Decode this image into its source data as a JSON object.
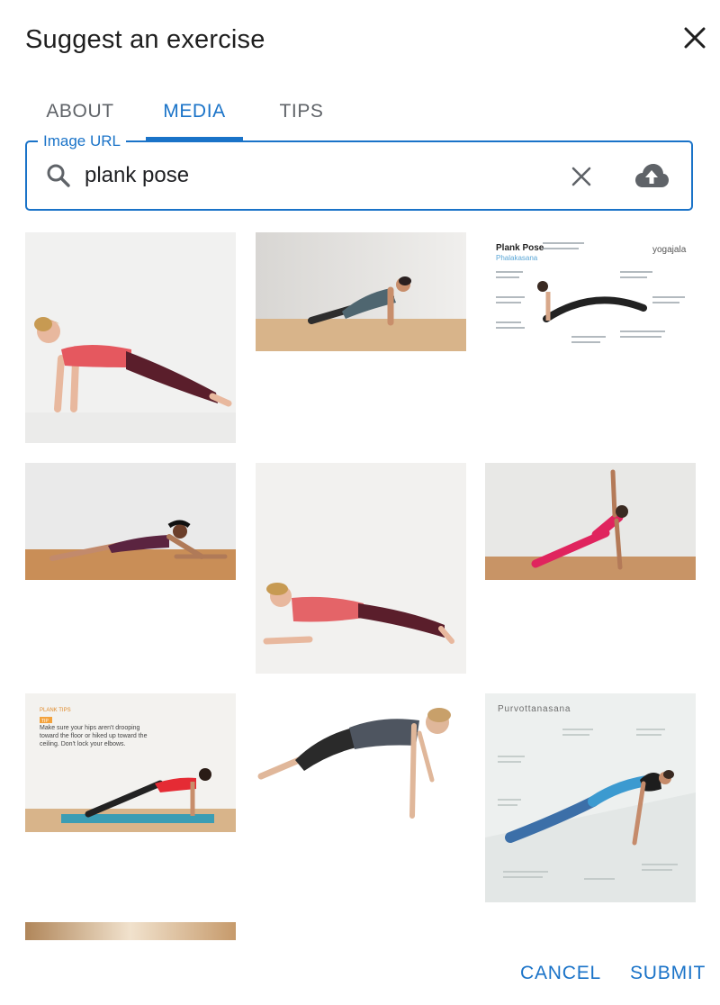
{
  "dialog": {
    "title": "Suggest an exercise"
  },
  "tabs": [
    {
      "label": "ABOUT",
      "active": false
    },
    {
      "label": "MEDIA",
      "active": true
    },
    {
      "label": "TIPS",
      "active": false
    }
  ],
  "search": {
    "label": "Image URL",
    "value": "plank pose"
  },
  "results": {
    "image3": {
      "title": "Plank Pose",
      "subtitle": "Phalakasana",
      "brand": "yogajala"
    },
    "image7": {
      "header": "PLANK TIPS",
      "tag": "TIP",
      "text": "Make sure your hips aren't drooping toward the floor or hiked up toward the ceiling. Don't lock your elbows."
    },
    "image9": {
      "title": "Purvottanasana"
    }
  },
  "actions": {
    "cancel": "CANCEL",
    "submit": "SUBMIT"
  },
  "colors": {
    "accent": "#1a73c8",
    "text": "#202124",
    "muted": "#5f6368"
  }
}
